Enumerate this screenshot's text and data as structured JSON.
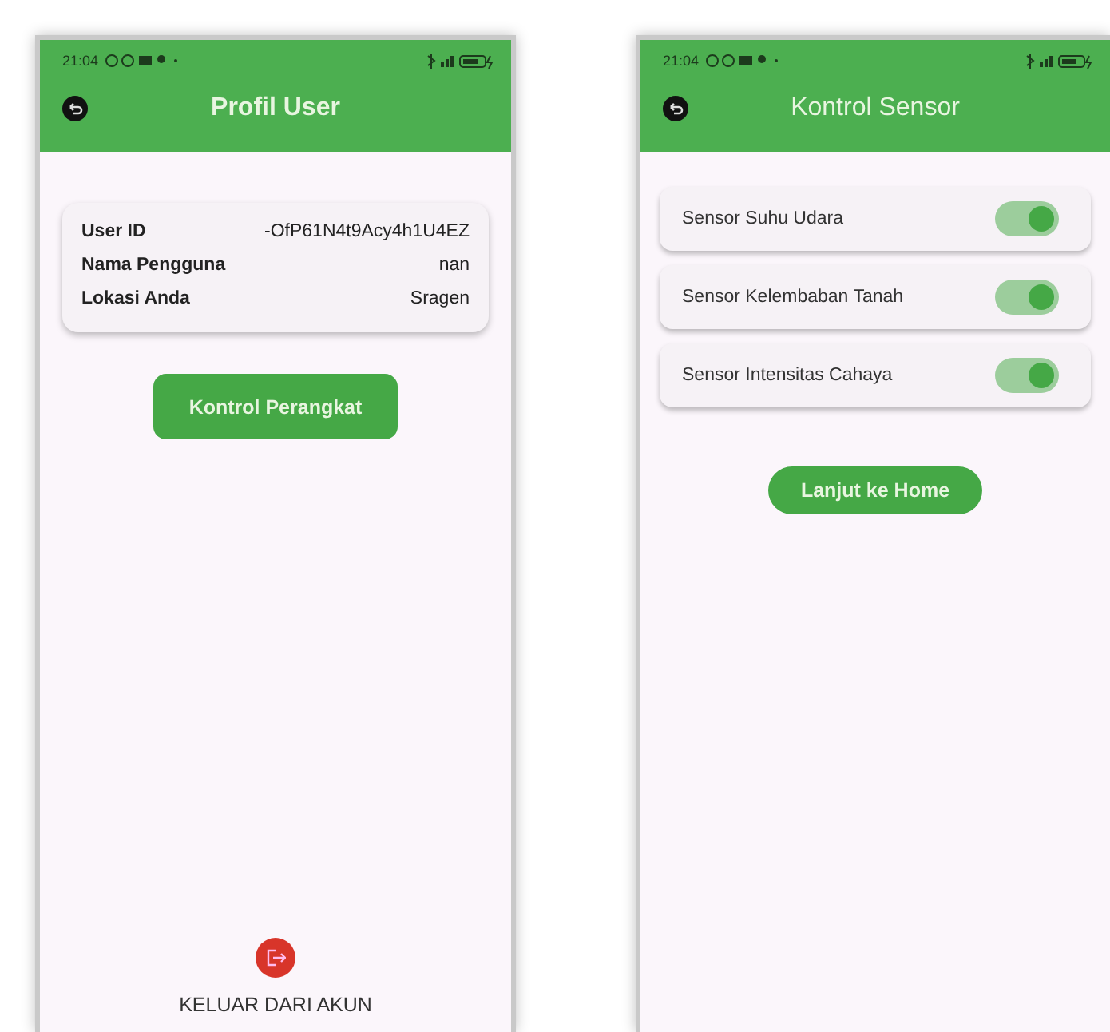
{
  "screens": [
    {
      "status_bar": {
        "time": "21:04"
      },
      "app_bar": {
        "title": "Profil User",
        "bold": true
      },
      "profile": {
        "rows": [
          {
            "label": "User ID",
            "value": "-OfP61N4t9Acy4h1U4EZ"
          },
          {
            "label": "Nama Pengguna",
            "value": "nan"
          },
          {
            "label": "Lokasi Anda",
            "value": "Sragen"
          }
        ]
      },
      "button": {
        "label": "Kontrol Perangkat",
        "kind": "rounded"
      },
      "logout": {
        "label": "KELUAR DARI AKUN"
      }
    },
    {
      "status_bar": {
        "time": "21:04"
      },
      "app_bar": {
        "title": "Kontrol Sensor",
        "bold": false
      },
      "sensors": [
        {
          "label": "Sensor Suhu Udara",
          "on": true
        },
        {
          "label": "Sensor Kelembaban Tanah",
          "on": true
        },
        {
          "label": "Sensor Intensitas Cahaya",
          "on": true
        }
      ],
      "button": {
        "label": "Lanjut ke Home",
        "kind": "pill"
      }
    }
  ]
}
